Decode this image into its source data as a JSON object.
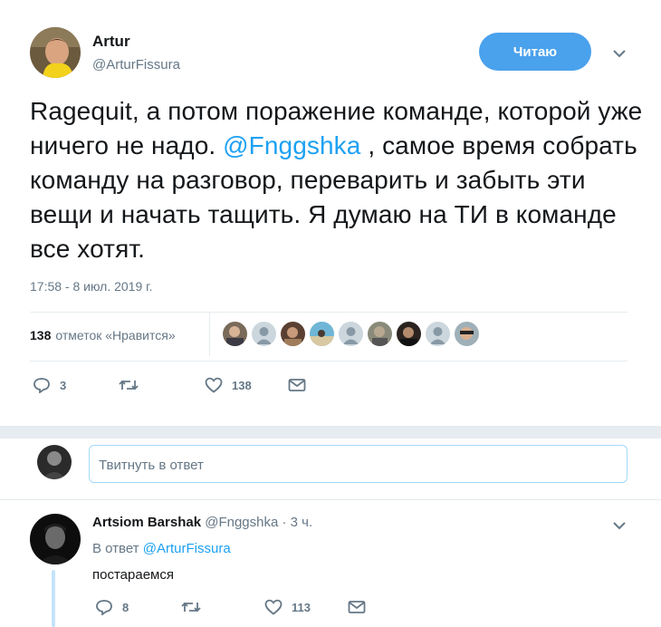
{
  "tweet": {
    "author_name": "Artur",
    "author_handle": "@ArturFissura",
    "follow_label": "Читаю",
    "text_before": "Ragequit, а потом поражение команде, которой уже ничего не надо. ",
    "mention": "@Fnggshka",
    "text_after": " , самое время собрать команду на разговор, переварить и забыть эти вещи и начать тащить. Я думаю на ТИ в команде все хотят.",
    "timestamp": "17:58 - 8 июл. 2019 г.",
    "likes_count": "138",
    "likes_label": "отметок «Нравится»",
    "actions": {
      "replies": "3",
      "retweets": "",
      "likes": "138"
    }
  },
  "reply_box": {
    "placeholder": "Твитнуть в ответ"
  },
  "reply": {
    "author_name": "Artsiom Barshak",
    "author_handle": "@Fnggshka",
    "dot": "·",
    "time": "3 ч.",
    "reply_to_prefix": "В ответ",
    "reply_to_handle": "@ArturFissura",
    "text": "постараемся",
    "actions": {
      "replies": "8",
      "retweets": "",
      "likes": "113"
    }
  },
  "colors": {
    "accent": "#1da1f2",
    "follow_button": "#4aa1ec",
    "muted": "#657786"
  }
}
